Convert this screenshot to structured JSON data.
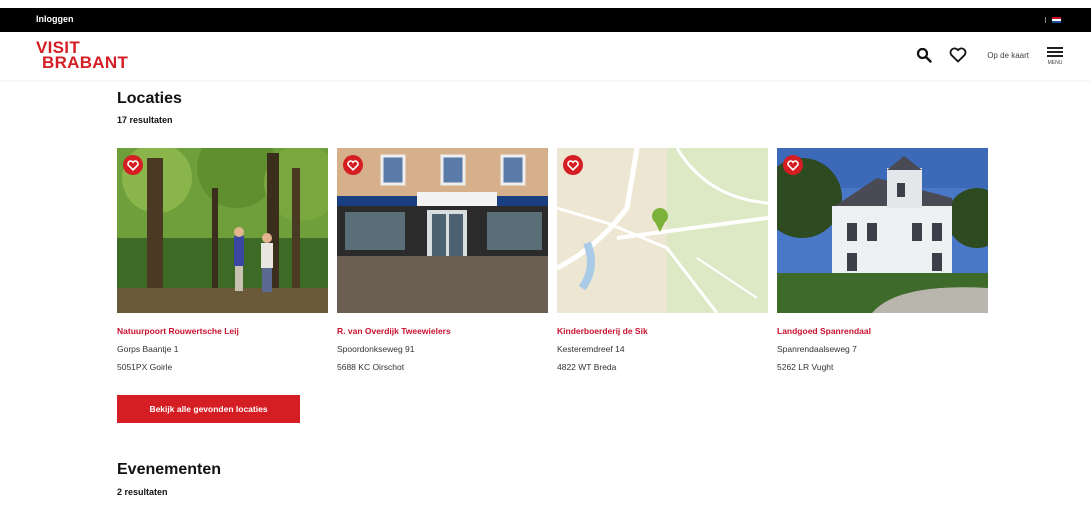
{
  "topbar": {
    "login_label": "Inloggen",
    "flag_icon": "dutch-flag-icon"
  },
  "header": {
    "logo_line1": "VISIT",
    "logo_line2": "BRABANT",
    "map_link": "Op de kaart",
    "menu_label": "MENU",
    "search_icon": "search-icon",
    "favorites_icon": "heart-icon",
    "menu_icon": "hamburger-icon"
  },
  "locations": {
    "title": "Locaties",
    "count": "17 resultaten",
    "button_label": "Bekijk alle gevonden locaties",
    "cards": [
      {
        "name": "Natuurpoort Rouwertsche Leij",
        "street": "Gorps Baantje 1",
        "city": "5051PX Goirle",
        "image": "forest-path"
      },
      {
        "name": "R. van Overdijk Tweewielers",
        "street": "Spoordonkseweg 91",
        "city": "5688 KC Oirschot",
        "image": "shop-front"
      },
      {
        "name": "Kinderboerderij de Sik",
        "street": "Kesteremdreef 14",
        "city": "4822 WT Breda",
        "image": "map"
      },
      {
        "name": "Landgoed Spanrendaal",
        "street": "Spanrendaalseweg 7",
        "city": "5262 LR Vught",
        "image": "manor-house"
      }
    ]
  },
  "events": {
    "title": "Evenementen",
    "count": "2 resultaten"
  },
  "colors": {
    "brand_red": "#d41e24",
    "link_red": "#c8102e",
    "topbar_black": "#000000"
  }
}
